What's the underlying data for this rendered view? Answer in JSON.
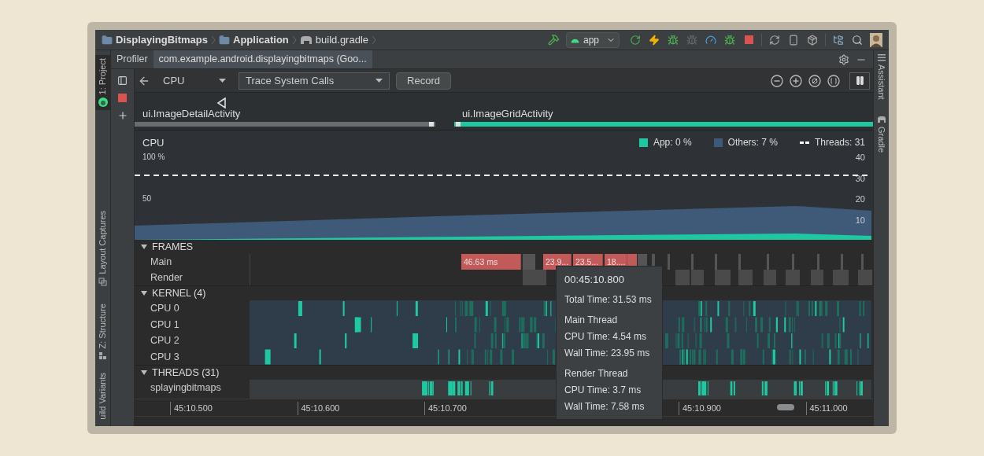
{
  "breadcrumbs": [
    {
      "label": "DisplayingBitmaps",
      "kind": "folder"
    },
    {
      "label": "Application",
      "kind": "folder"
    },
    {
      "label": "build.gradle",
      "kind": "gradle"
    }
  ],
  "run_config": {
    "label": "app"
  },
  "tool_strip_left": [
    {
      "label": "1: Project",
      "selected": true
    },
    {
      "label": "Layout Captures",
      "selected": false
    },
    {
      "label": "Z: Structure",
      "selected": false
    },
    {
      "label": "uild Variants",
      "selected": false
    }
  ],
  "tool_strip_right": [
    {
      "label": "Assistant"
    },
    {
      "label": "Gradle"
    }
  ],
  "tabs": [
    {
      "label": "Profiler",
      "selected": false
    },
    {
      "label": "com.example.android.displayingbitmaps (Goo...",
      "selected": true
    }
  ],
  "profiler_toolbar": {
    "monitor": "CPU",
    "config": "Trace System Calls",
    "record_button": "Record"
  },
  "activities": [
    {
      "label": "ui.ImageDetailActivity",
      "active": false
    },
    {
      "label": "ui.ImageGridActivity",
      "active": true
    }
  ],
  "cpu": {
    "title": "CPU",
    "legend": [
      {
        "label": "App: 0 %",
        "kind": "swatch",
        "color": "#1ec8a0"
      },
      {
        "label": "Others: 7 %",
        "kind": "swatch",
        "color": "#3e5a78"
      },
      {
        "label": "Threads: 31",
        "kind": "dashed"
      }
    ],
    "threads_axis": [
      "40",
      "30",
      "20",
      "10"
    ],
    "usage_axis": [
      "100 %",
      "50"
    ]
  },
  "frames": {
    "title": "FRAMES",
    "expanded": true,
    "tracks": [
      "Main",
      "Render"
    ],
    "main_frames": [
      {
        "label": "46.63 ms"
      },
      {
        "label": "23.9..."
      },
      {
        "label": "23.5..."
      },
      {
        "label": "18...."
      }
    ]
  },
  "kernel": {
    "title": "KERNEL (4)",
    "expanded": true,
    "cpus": [
      "CPU 0",
      "CPU 1",
      "CPU 2",
      "CPU 3"
    ]
  },
  "threads": {
    "title": "THREADS (31)",
    "expanded": true,
    "items": [
      "splayingbitmaps"
    ]
  },
  "time_axis": [
    "45:10.500",
    "45:10.600",
    "45:10.700",
    "45:10.900",
    "45:11.000"
  ],
  "tooltip": {
    "time": "00:45:10.800",
    "total": "Total Time: 31.53 ms",
    "sections": [
      {
        "title": "Main Thread",
        "lines": [
          "CPU Time: 4.54 ms",
          "Wall Time: 23.95 ms"
        ]
      },
      {
        "title": "Render Thread",
        "lines": [
          "CPU Time: 3.7 ms",
          "Wall Time: 7.58 ms"
        ]
      }
    ]
  }
}
